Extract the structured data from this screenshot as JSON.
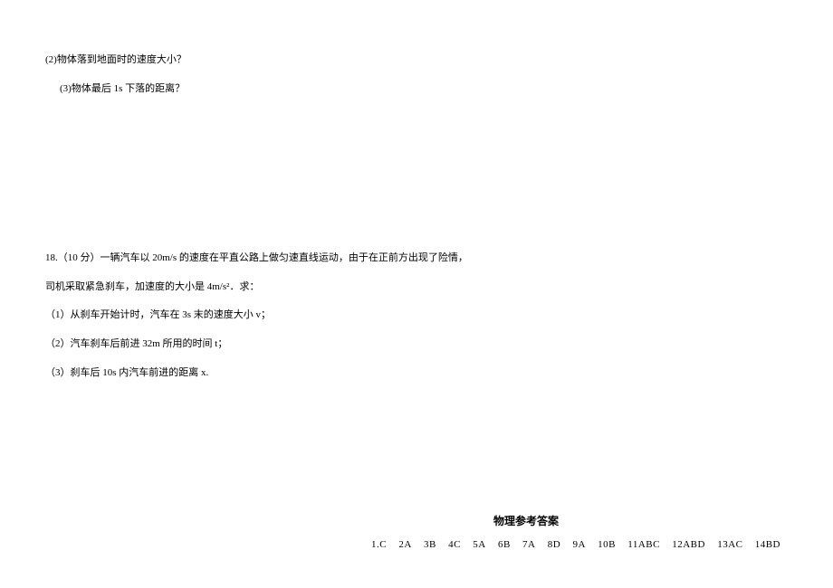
{
  "questions": {
    "q17_part2": "(2)物体落到地面时的速度大小？",
    "q17_part3": "(3)物体最后 1s 下落的距离？",
    "q18_intro": "18.（10 分）一辆汽车以 20m/s 的速度在平直公路上做匀速直线运动，由于在正前方出现了险情，",
    "q18_intro2": "司机采取紧急刹车，加速度的大小是 4m/s²．求：",
    "q18_part1": "（1）从刹车开始计时，汽车在 3s 末的速度大小 v；",
    "q18_part2": "（2）汽车刹车后前进 32m 所用的时间 t；",
    "q18_part3": "（3）刹车后 10s 内汽车前进的距离 x."
  },
  "answers": {
    "title": "物理参考答案",
    "keys": [
      "1.C",
      "2A",
      "3B",
      "4C",
      "5A",
      "6B",
      "7A",
      "8D",
      "9A",
      "10B",
      "11ABC",
      "12ABD",
      "13AC",
      "14BD"
    ]
  }
}
